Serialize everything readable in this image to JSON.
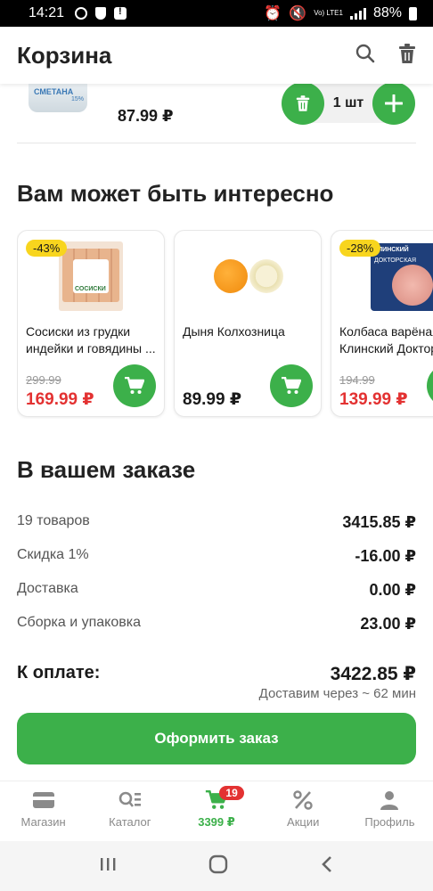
{
  "status_bar": {
    "time": "14:21",
    "lte": "Vo) LTE1",
    "battery": "88%"
  },
  "header": {
    "title": "Корзина"
  },
  "cart_item": {
    "jar_label": "СМЕТАНА",
    "jar_fat": "15%",
    "price": "87.99 ₽",
    "quantity": "1 шт"
  },
  "recommendations": {
    "title": "Вам может быть интересно",
    "items": [
      {
        "badge": "-43%",
        "name": "Сосиски из грудки индейки и говядины ...",
        "old_price": "299.99",
        "price": "169.99 ₽",
        "pack_label": "СОСИСКИ"
      },
      {
        "badge": "",
        "name": "Дыня Колхозница",
        "old_price": "",
        "price": "89.99 ₽"
      },
      {
        "badge": "-28%",
        "name": "Колбаса варёная Клинский Доктор...",
        "old_price": "194.99",
        "price": "139.99 ₽",
        "pack_label": "ДОКТОРСКАЯ",
        "brand_label": "КЛИНСКИЙ"
      }
    ]
  },
  "order": {
    "title": "В вашем заказе",
    "rows": [
      {
        "label": "19 товаров",
        "value": "3415.85 ₽"
      },
      {
        "label": "Скидка 1%",
        "value": "-16.00 ₽"
      },
      {
        "label": "Доставка",
        "value": "0.00 ₽"
      },
      {
        "label": "Сборка и упаковка",
        "value": "23.00 ₽"
      }
    ],
    "total_label": "К оплате:",
    "total_value": "3422.85 ₽",
    "eta": "Доставим через ~ 62 мин",
    "button": "Оформить заказ"
  },
  "bottom_nav": {
    "items": [
      {
        "label": "Магазин"
      },
      {
        "label": "Каталог"
      },
      {
        "label": "3399 ₽",
        "badge": "19"
      },
      {
        "label": "Акции"
      },
      {
        "label": "Профиль"
      }
    ]
  },
  "colors": {
    "accent": "#3cb04a",
    "sale": "#e33232",
    "badge": "#f8d51e"
  }
}
